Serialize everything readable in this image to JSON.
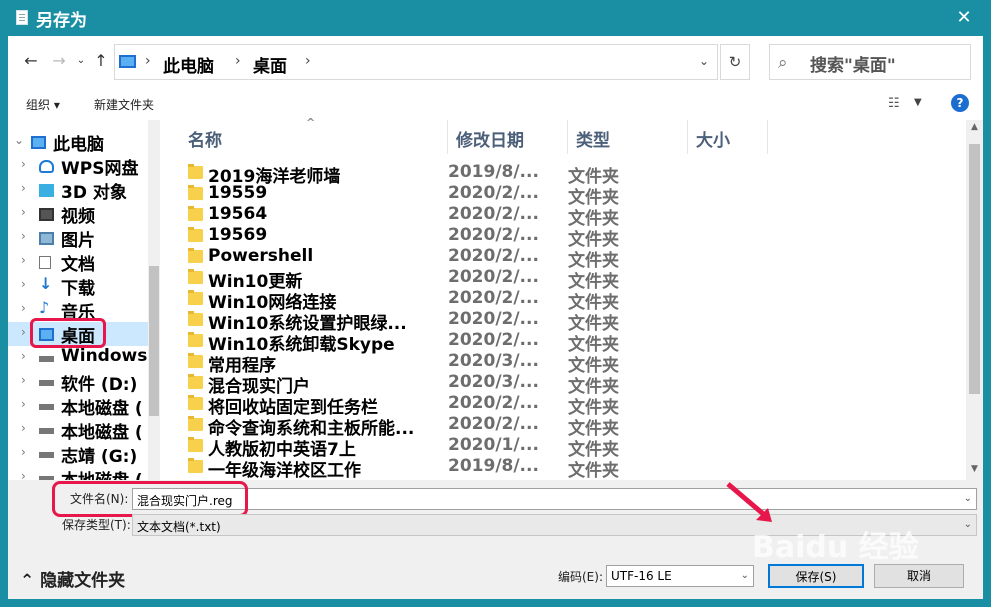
{
  "window": {
    "title": "另存为"
  },
  "nav": {
    "address": [
      "此电脑",
      "桌面"
    ],
    "search_placeholder": "搜索\"桌面\""
  },
  "toolbar": {
    "organize": "组织 ▾",
    "new_folder": "新建文件夹",
    "help": "?"
  },
  "tree": [
    {
      "label": "此电脑",
      "icon": "pc-icon",
      "root": true
    },
    {
      "label": "WPS网盘",
      "icon": "cloud-icon"
    },
    {
      "label": "3D 对象",
      "icon": "3d-objects-icon"
    },
    {
      "label": "视频",
      "icon": "video-icon"
    },
    {
      "label": "图片",
      "icon": "pictures-icon"
    },
    {
      "label": "文档",
      "icon": "documents-icon"
    },
    {
      "label": "下载",
      "icon": "download-icon"
    },
    {
      "label": "音乐",
      "icon": "music-icon"
    },
    {
      "label": "桌面",
      "icon": "desktop-icon",
      "selected": true
    },
    {
      "label": "Windows",
      "icon": "drive-icon"
    },
    {
      "label": "软件 (D:)",
      "icon": "drive-icon"
    },
    {
      "label": "本地磁盘 (",
      "icon": "drive-icon"
    },
    {
      "label": "本地磁盘 (",
      "icon": "drive-icon"
    },
    {
      "label": "志靖 (G:)",
      "icon": "drive-icon"
    },
    {
      "label": "本地磁盘 (",
      "icon": "drive-icon"
    }
  ],
  "columns": {
    "name": "名称",
    "date": "修改日期",
    "type": "类型",
    "size": "大小"
  },
  "files": [
    {
      "name": "2019海洋老师墙",
      "date": "2019/8/...",
      "type": "文件夹"
    },
    {
      "name": "19559",
      "date": "2020/2/...",
      "type": "文件夹"
    },
    {
      "name": "19564",
      "date": "2020/2/...",
      "type": "文件夹"
    },
    {
      "name": "19569",
      "date": "2020/2/...",
      "type": "文件夹"
    },
    {
      "name": "Powershell",
      "date": "2020/2/...",
      "type": "文件夹"
    },
    {
      "name": "Win10更新",
      "date": "2020/2/...",
      "type": "文件夹"
    },
    {
      "name": "Win10网络连接",
      "date": "2020/2/...",
      "type": "文件夹"
    },
    {
      "name": "Win10系统设置护眼绿...",
      "date": "2020/2/...",
      "type": "文件夹"
    },
    {
      "name": "Win10系统卸载Skype",
      "date": "2020/2/...",
      "type": "文件夹"
    },
    {
      "name": "常用程序",
      "date": "2020/3/...",
      "type": "文件夹"
    },
    {
      "name": "混合现实门户",
      "date": "2020/3/...",
      "type": "文件夹"
    },
    {
      "name": "将回收站固定到任务栏",
      "date": "2020/2/...",
      "type": "文件夹"
    },
    {
      "name": "命令查询系统和主板所能...",
      "date": "2020/2/...",
      "type": "文件夹"
    },
    {
      "name": "人教版初中英语7上",
      "date": "2020/1/...",
      "type": "文件夹"
    },
    {
      "name": "一年级海洋校区工作",
      "date": "2019/8/...",
      "type": "文件夹"
    }
  ],
  "form": {
    "filename_label": "文件名(N):",
    "filename_value": "混合现实门户.reg",
    "filetype_label": "保存类型(T):",
    "filetype_value": "文本文档(*.txt)",
    "encoding_label": "编码(E):",
    "encoding_value": "UTF-16 LE",
    "hide_folders": "隐藏文件夹",
    "save_button": "保存(S)",
    "cancel_button": "取消"
  },
  "colors": {
    "titlebar": "#1a8fa3",
    "highlight": "#e8174b",
    "selection": "#cce8ff",
    "folder": "#f7d14b"
  }
}
